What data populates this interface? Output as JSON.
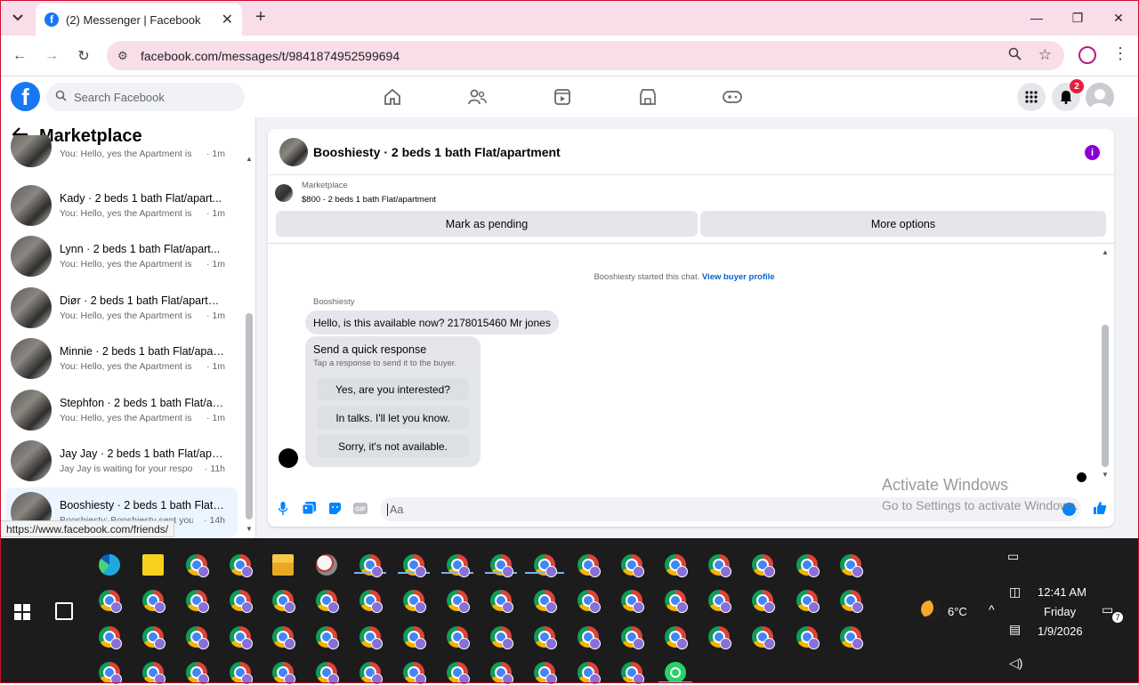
{
  "browser": {
    "tab_title": "(2) Messenger | Facebook",
    "url": "facebook.com/messages/t/9841874952599694",
    "status_url": "https://www.facebook.com/friends/"
  },
  "fb": {
    "search_placeholder": "Search Facebook",
    "notification_count": "2"
  },
  "left": {
    "title": "Marketplace",
    "conversations": [
      {
        "name": "",
        "preview": "You: Hello, yes the Apartment is st...",
        "time": "· 1m"
      },
      {
        "name": "Kady · 2 beds 1 bath Flat/apart...",
        "preview": "You: Hello, yes the Apartment is st...",
        "time": "· 1m"
      },
      {
        "name": "Lynn · 2 beds 1 bath Flat/apart...",
        "preview": "You: Hello, yes the Apartment is st...",
        "time": "· 1m"
      },
      {
        "name": "Diør · 2 beds 1 bath Flat/apartm...",
        "preview": "You: Hello, yes the Apartment is st...",
        "time": "· 1m"
      },
      {
        "name": "Minnie · 2 beds 1 bath Flat/apar...",
        "preview": "You: Hello, yes the Apartment is st...",
        "time": "· 1m"
      },
      {
        "name": "Stephfon · 2 beds 1 bath Flat/ap...",
        "preview": "You: Hello, yes the Apartment is st...",
        "time": "· 1m"
      },
      {
        "name": "Jay Jay · 2 beds 1 bath Flat/apar...",
        "preview": "Jay Jay is waiting for your respon...",
        "time": "· 11h"
      },
      {
        "name": "Booshiesty · 2 beds 1 bath Flat/...",
        "preview": "Booshiesty: Booshiesty sent you a ...",
        "time": "· 14h"
      }
    ]
  },
  "chat": {
    "title": "Booshiesty · 2 beds 1 bath Flat/apartment",
    "marketplace_label": "Marketplace",
    "listing": "$800 - 2 beds 1 bath Flat/apartment",
    "mark_pending": "Mark as pending",
    "more_options": "More options",
    "system_text": "Booshiesty started this chat.",
    "system_link": "View buyer profile",
    "sender": "Booshiesty",
    "message": "Hello, is this available now? 2178015460 Mr jones",
    "quick_title": "Send a quick response",
    "quick_sub": "Tap a response to send it to the buyer.",
    "quick_options": [
      "Yes, are you interested?",
      "In talks. I'll let you know.",
      "Sorry, it's not available."
    ],
    "input_placeholder": "Aa"
  },
  "watermark": {
    "line1": "Activate Windows",
    "line2": "Go to Settings to activate Windows."
  },
  "taskbar": {
    "temperature": "6°C",
    "time": "12:41 AM",
    "day": "Friday",
    "date": "1/9/2026",
    "notif_count": "7"
  },
  "colors": {
    "fb_blue": "#1877f2",
    "chrome_pink": "#f9dde8",
    "badge_red": "#e41e3f",
    "link_blue": "#0064d1"
  }
}
